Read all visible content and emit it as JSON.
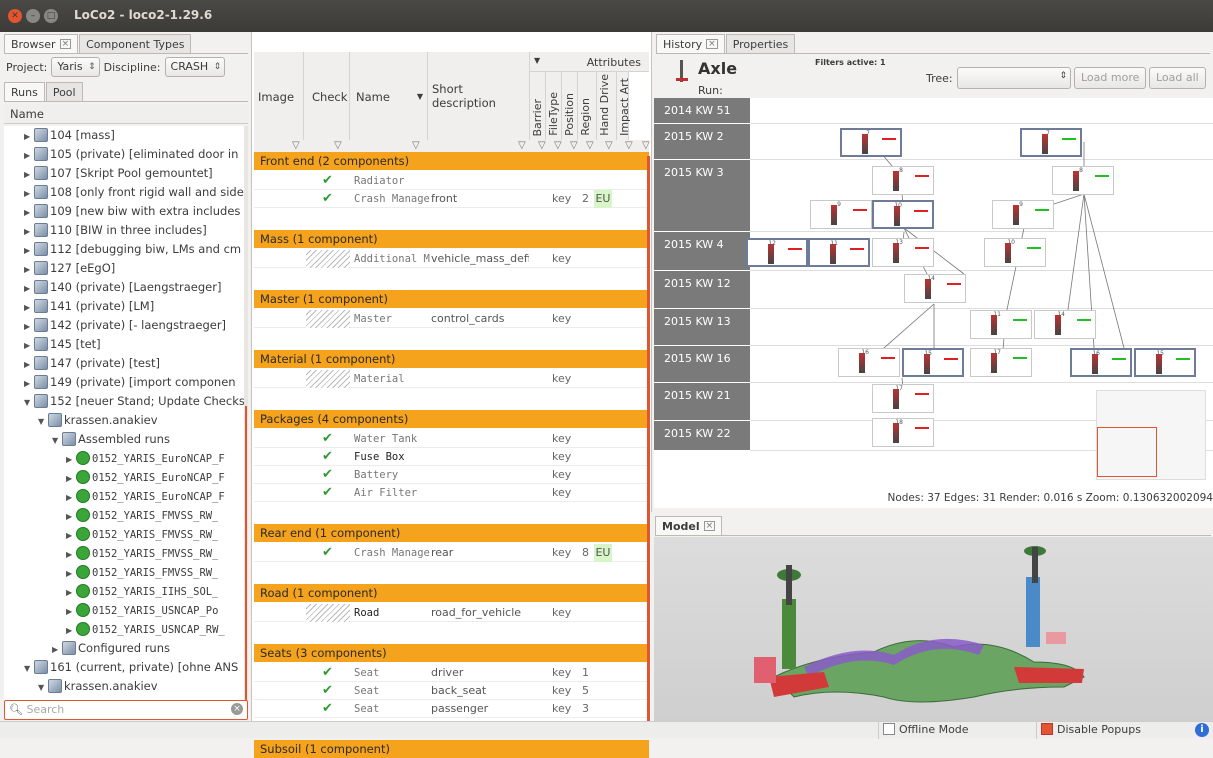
{
  "window": {
    "title": "LoCo2 - loco2-1.29.6"
  },
  "left_tabs": [
    "Browser",
    "Component Types"
  ],
  "left_toolbar": {
    "project_label": "Project:",
    "project_value": "Yaris",
    "discipline_label": "Discipline:",
    "discipline_value": "CRASH"
  },
  "runs_tabs": [
    "Runs",
    "Pool"
  ],
  "tree_header": "Name",
  "tree_items": [
    {
      "label": "104 [mass]",
      "type": "file",
      "indent": 1
    },
    {
      "label": "105 (private) [eliminated door in",
      "type": "file",
      "indent": 1
    },
    {
      "label": "107 [Skript Pool gemountet]",
      "type": "file",
      "indent": 1
    },
    {
      "label": "108 [only front rigid wall and side",
      "type": "file",
      "indent": 1
    },
    {
      "label": "109 [new biw with extra includes",
      "type": "file",
      "indent": 1
    },
    {
      "label": "110 [BIW in three includes]",
      "type": "file",
      "indent": 1
    },
    {
      "label": "112 [debugging biw, LMs and cm",
      "type": "file",
      "indent": 1
    },
    {
      "label": "127 [eEgO]",
      "type": "file",
      "indent": 1
    },
    {
      "label": "140 (private) [Laengstraeger]",
      "type": "file",
      "indent": 1
    },
    {
      "label": "141 (private) [LM]",
      "type": "file",
      "indent": 1
    },
    {
      "label": "142 (private) [- laengstraeger]",
      "type": "file",
      "indent": 1
    },
    {
      "label": "145 [tet]",
      "type": "file",
      "indent": 1
    },
    {
      "label": "147 (private) [test]",
      "type": "file",
      "indent": 1
    },
    {
      "label": "149 (private) [import componen",
      "type": "file",
      "indent": 1
    },
    {
      "label": "152 [neuer Stand; Update Checks",
      "type": "file",
      "indent": 1,
      "open": true
    },
    {
      "label": "krassen.anakiev",
      "type": "file",
      "indent": 2,
      "open": true
    },
    {
      "label": "Assembled runs",
      "type": "file",
      "indent": 3,
      "open": true
    },
    {
      "label": "0152_YARIS_EuroNCAP_F",
      "type": "run",
      "indent": 4
    },
    {
      "label": "0152_YARIS_EuroNCAP_F",
      "type": "run",
      "indent": 4
    },
    {
      "label": "0152_YARIS_EuroNCAP_F",
      "type": "run",
      "indent": 4
    },
    {
      "label": "0152_YARIS_FMVSS_RW_",
      "type": "run",
      "indent": 4
    },
    {
      "label": "0152_YARIS_FMVSS_RW_",
      "type": "run",
      "indent": 4
    },
    {
      "label": "0152_YARIS_FMVSS_RW_",
      "type": "run",
      "indent": 4
    },
    {
      "label": "0152_YARIS_FMVSS_RW_",
      "type": "run",
      "indent": 4
    },
    {
      "label": "0152_YARIS_IIHS_SOL_",
      "type": "run",
      "indent": 4
    },
    {
      "label": "0152_YARIS_USNCAP_Po",
      "type": "run",
      "indent": 4
    },
    {
      "label": "0152_YARIS_USNCAP_RW_",
      "type": "run",
      "indent": 4
    },
    {
      "label": "Configured runs",
      "type": "file",
      "indent": 3
    },
    {
      "label": "161 (current, private) [ohne ANS",
      "type": "file",
      "indent": 1,
      "open": true
    },
    {
      "label": "krassen.anakiev",
      "type": "file",
      "indent": 2,
      "open": true
    }
  ],
  "search_placeholder": "Search",
  "table": {
    "headers": {
      "image": "Image",
      "check": "Check",
      "name": "Name",
      "short": "Short description",
      "attributes": "Attributes"
    },
    "attr_cols": [
      "Barrier",
      "FileType",
      "Position",
      "Region",
      "Hand Drive",
      "Impact Art"
    ],
    "groups": [
      {
        "title": "Front end (2 components)",
        "rows": [
          {
            "name": "Radiator",
            "short": "",
            "type": "",
            "pos": "",
            "region": "",
            "check": true
          },
          {
            "name": "Crash Manage",
            "short": "front",
            "type": "key",
            "pos": "2",
            "region": "EU",
            "check": true
          }
        ]
      },
      {
        "title": "Mass (1 component)",
        "rows": [
          {
            "name": "Additional M",
            "short": "vehicle_mass_defi",
            "type": "key",
            "pos": "",
            "region": "",
            "check": false
          }
        ]
      },
      {
        "title": "Master (1 component)",
        "rows": [
          {
            "name": "Master",
            "short": "control_cards",
            "type": "key",
            "pos": "",
            "region": "",
            "check": false
          }
        ]
      },
      {
        "title": "Material (1 component)",
        "rows": [
          {
            "name": "Material",
            "short": "",
            "type": "key",
            "pos": "",
            "region": "",
            "check": false
          }
        ]
      },
      {
        "title": "Packages (4 components)",
        "rows": [
          {
            "name": "Water Tank",
            "short": "",
            "type": "key",
            "pos": "",
            "region": "",
            "check": true
          },
          {
            "name": "Fuse Box",
            "short": "",
            "type": "key",
            "pos": "",
            "region": "",
            "check": true
          },
          {
            "name": "Battery",
            "short": "",
            "type": "key",
            "pos": "",
            "region": "",
            "check": true
          },
          {
            "name": "Air Filter",
            "short": "",
            "type": "key",
            "pos": "",
            "region": "",
            "check": true
          }
        ]
      },
      {
        "title": "Rear end (1 component)",
        "rows": [
          {
            "name": "Crash Manage",
            "short": "rear",
            "type": "key",
            "pos": "8",
            "region": "EU",
            "check": true
          }
        ]
      },
      {
        "title": "Road (1 component)",
        "rows": [
          {
            "name": "Road",
            "short": "road_for_vehicle",
            "type": "key",
            "pos": "",
            "region": "",
            "check": false
          }
        ]
      },
      {
        "title": "Seats (3 components)",
        "rows": [
          {
            "name": "Seat",
            "short": "driver",
            "type": "key",
            "pos": "1",
            "region": "",
            "check": true
          },
          {
            "name": "Seat",
            "short": "back_seat",
            "type": "key",
            "pos": "5",
            "region": "",
            "check": true
          },
          {
            "name": "Seat",
            "short": "passenger",
            "type": "key",
            "pos": "3",
            "region": "",
            "check": true
          }
        ]
      },
      {
        "title": "Subsoil (1 component)",
        "rows": []
      }
    ]
  },
  "history": {
    "tabs": [
      "History",
      "Properties"
    ],
    "component": "Axle",
    "run_label": "Run:",
    "filters": "Filters active: 1",
    "tree_label": "Tree:",
    "load_more": "Load more",
    "load_all": "Load all",
    "weeks": [
      "2014 KW 51",
      "2015 KW 2",
      "2015 KW 3",
      "2015 KW 4",
      "2015 KW 12",
      "2015 KW 13",
      "2015 KW 16",
      "2015 KW 21",
      "2015 KW 22"
    ],
    "node_numbers": [
      "7",
      "7",
      "8",
      "8",
      "9",
      "10",
      "9",
      "12",
      "11",
      "13",
      "10",
      "14",
      "11",
      "14",
      "16",
      "15",
      "17",
      "16",
      "15",
      "17",
      "18"
    ],
    "stats": "Nodes: 37 Edges: 31 Render: 0.016 s Zoom: 0.130632002094"
  },
  "model": {
    "tab": "Model"
  },
  "status": {
    "offline": "Offline Mode",
    "popups": "Disable Popups"
  },
  "colors": {
    "group": "#f5a21d",
    "region": "#d8f5c8",
    "accent": "#e25530"
  }
}
